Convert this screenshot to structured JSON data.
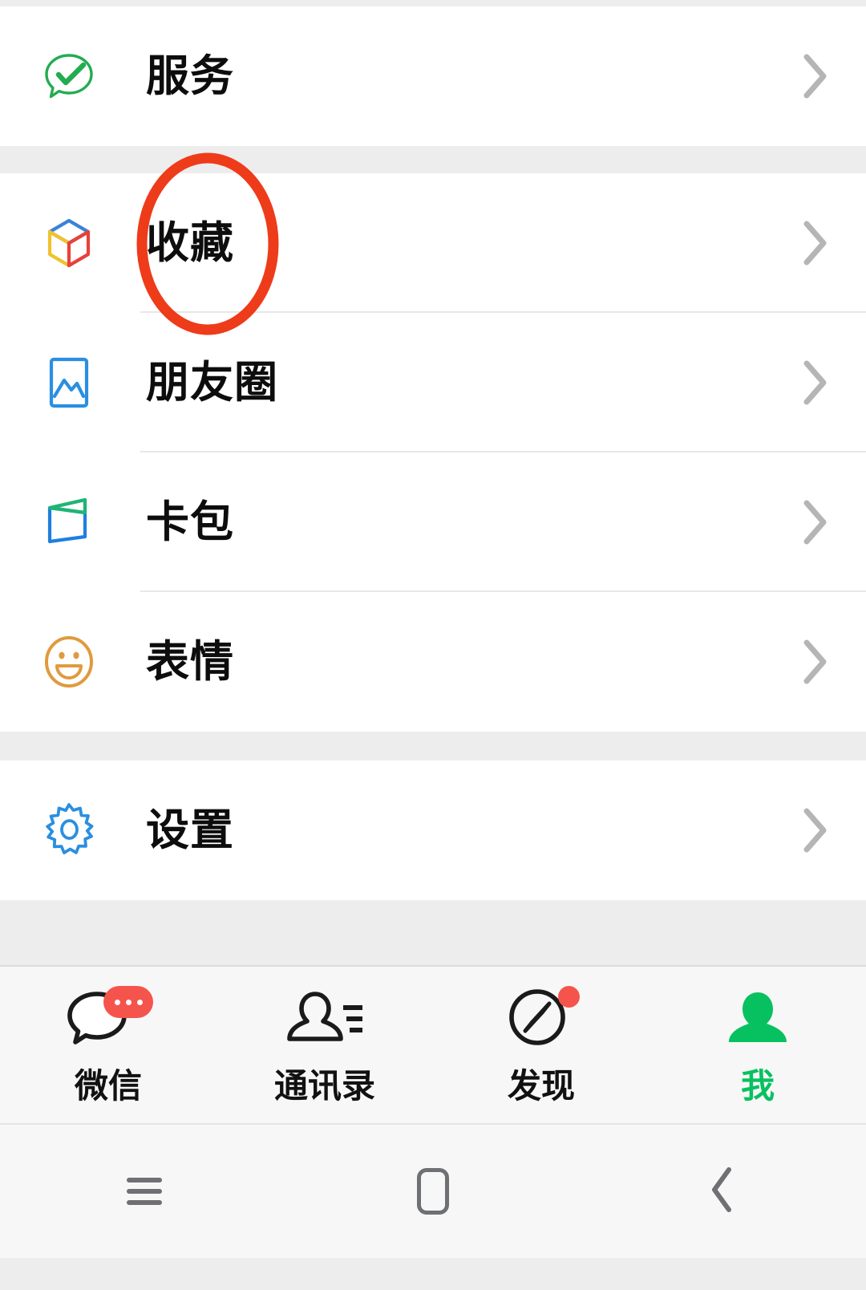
{
  "app": {
    "name": "WeChat",
    "screen": "Me"
  },
  "colors": {
    "accent_green": "#07c160",
    "badge_red": "#f5544c",
    "annotation_red": "#ee3b1a",
    "page_background": "#ededed",
    "card_background": "#ffffff",
    "tabbar_background": "#f7f7f7",
    "label_text": "#0d0d0d",
    "chevron_gray": "#b5b5b5"
  },
  "sections": [
    {
      "id": "services-section",
      "items": [
        {
          "id": "services",
          "label": "服务",
          "icon": "service-checkmark-icon",
          "icon_color": "#22ac50",
          "chevron": "›"
        }
      ]
    },
    {
      "id": "personal-section",
      "items": [
        {
          "id": "favorites",
          "label": "收藏",
          "icon": "cube-favorites-icon",
          "icon_color": "#3b82d8",
          "chevron": "›"
        },
        {
          "id": "moments",
          "label": "朋友圈",
          "icon": "photo-moments-icon",
          "icon_color": "#2b8fe0",
          "chevron": "›"
        },
        {
          "id": "cards-offers",
          "label": "卡包",
          "icon": "wallet-cards-icon",
          "icon_color": "#1f7fe0",
          "chevron": "›"
        },
        {
          "id": "stickers",
          "label": "表情",
          "icon": "smiley-stickers-icon",
          "icon_color": "#e09a3d",
          "chevron": "›"
        }
      ]
    },
    {
      "id": "settings-section",
      "items": [
        {
          "id": "settings",
          "label": "设置",
          "icon": "gear-settings-icon",
          "icon_color": "#2b8fe0",
          "chevron": "›"
        }
      ]
    }
  ],
  "annotation": {
    "type": "ellipse",
    "target": "收藏",
    "color": "#ee3b1a",
    "stroke_width": 13
  },
  "tabbar": {
    "tabs": [
      {
        "id": "chats",
        "label": "微信",
        "icon": "chat-bubble-icon",
        "active": false,
        "badge": "dots"
      },
      {
        "id": "contacts",
        "label": "通讯录",
        "icon": "contacts-person-icon",
        "active": false,
        "badge": "none"
      },
      {
        "id": "discover",
        "label": "发现",
        "icon": "compass-icon",
        "active": false,
        "badge": "dot"
      },
      {
        "id": "me",
        "label": "我",
        "icon": "person-filled-icon",
        "active": true,
        "badge": "none"
      }
    ]
  },
  "navbar": {
    "buttons": [
      {
        "id": "recents",
        "icon": "hamburger-recents-icon"
      },
      {
        "id": "home",
        "icon": "square-home-icon"
      },
      {
        "id": "back",
        "icon": "chevron-back-icon"
      }
    ]
  }
}
